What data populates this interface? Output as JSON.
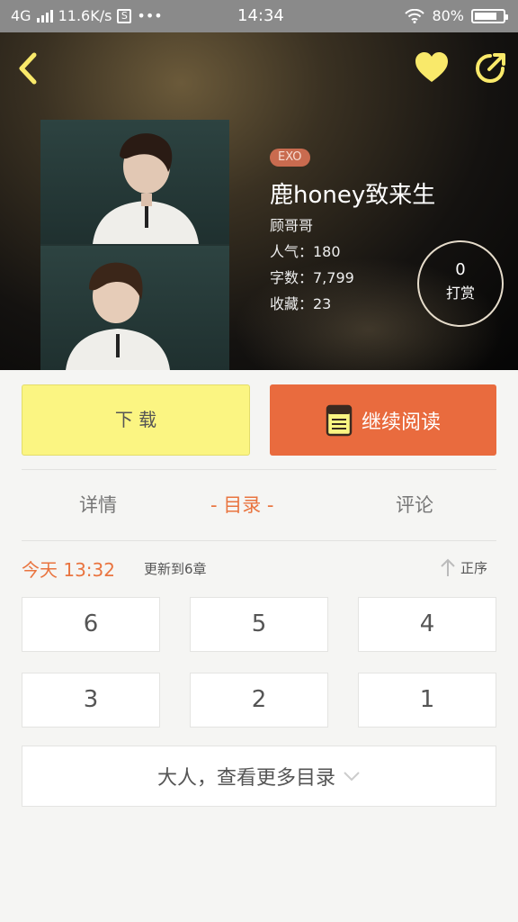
{
  "status_bar": {
    "network": "4G",
    "speed": "11.6K/s",
    "sim_icon": "S",
    "dots": "•••",
    "time": "14:34",
    "battery_percent": "80%",
    "battery_level": 0.8
  },
  "book": {
    "tag": "EXO",
    "title": "鹿honey致来生",
    "author": "顾哥哥",
    "popularity": "人气：180",
    "word_count": "字数：7,799",
    "favorites": "收藏：23",
    "tip_count": "0",
    "tip_label": "打赏"
  },
  "actions": {
    "download": "下 载",
    "continue_reading": "继续阅读"
  },
  "tabs": [
    {
      "label": "详情"
    },
    {
      "label": "- 目录 -"
    },
    {
      "label": "评论"
    }
  ],
  "update": {
    "date": "今天 13:32",
    "note": "更新到6章",
    "sort_label": "正序"
  },
  "chapters": [
    "6",
    "5",
    "4",
    "3",
    "2",
    "1"
  ],
  "more_label": "大人，查看更多目录",
  "colors": {
    "accent": "#e9743f",
    "download_bg": "#fbf582",
    "read_bg": "#e96b3e",
    "heart": "#f9e96a",
    "tag_bg": "#c96b4f"
  },
  "icons": [
    "back-arrow-icon",
    "heart-icon",
    "share-icon",
    "book-icon",
    "sort-arrow-icon",
    "chevron-down-icon"
  ]
}
